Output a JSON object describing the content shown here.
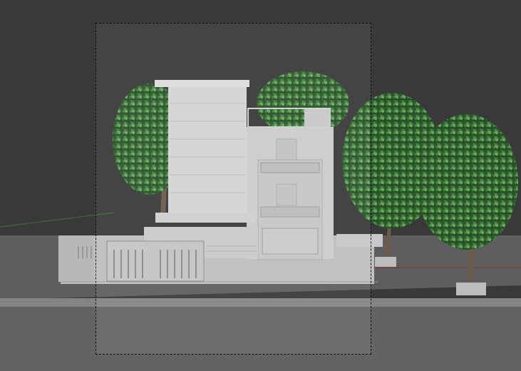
{
  "viewport": {
    "background_color": "#393939",
    "ground_color": "#5d5d5d",
    "road_color": "#6a6a6a",
    "building_color": "#cfcfcf",
    "foliage_color": "#3f7a3c",
    "trunk_color": "#6c5a4a"
  },
  "objects": {
    "trees": [
      "tree-left",
      "tree-right-1",
      "tree-right-2",
      "tree-rooftop"
    ],
    "building": "house-model",
    "camera": "camera-frame"
  }
}
